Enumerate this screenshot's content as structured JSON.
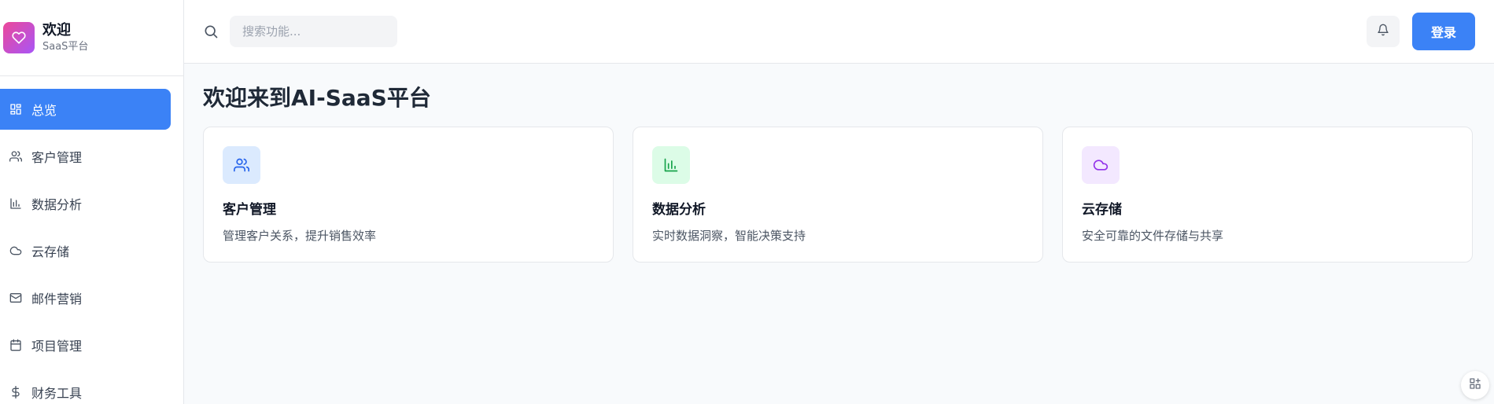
{
  "brand": {
    "title": "欢迎",
    "subtitle": "SaaS平台",
    "icon": "heart-icon"
  },
  "sidebar": {
    "items": [
      {
        "label": "总览",
        "icon": "dashboard-icon",
        "active": true
      },
      {
        "label": "客户管理",
        "icon": "users-icon"
      },
      {
        "label": "数据分析",
        "icon": "bar-chart-icon"
      },
      {
        "label": "云存储",
        "icon": "cloud-icon"
      },
      {
        "label": "邮件营销",
        "icon": "mail-icon"
      },
      {
        "label": "项目管理",
        "icon": "calendar-icon"
      },
      {
        "label": "财务工具",
        "icon": "dollar-icon"
      }
    ]
  },
  "header": {
    "search_placeholder": "搜索功能...",
    "login_label": "登录"
  },
  "main": {
    "title": "欢迎来到AI-SaaS平台",
    "cards": [
      {
        "title": "客户管理",
        "desc": "管理客户关系，提升销售效率",
        "icon": "users-icon",
        "color": "#dbeafe"
      },
      {
        "title": "数据分析",
        "desc": "实时数据洞察，智能决策支持",
        "icon": "bar-chart-icon",
        "color": "#dcfce7"
      },
      {
        "title": "云存储",
        "desc": "安全可靠的文件存储与共享",
        "icon": "cloud-icon",
        "color": "#f3e8ff"
      }
    ]
  },
  "colors": {
    "accent": "#3b82f6",
    "brand_gradient_start": "#ec4899",
    "brand_gradient_end": "#a855f7"
  }
}
